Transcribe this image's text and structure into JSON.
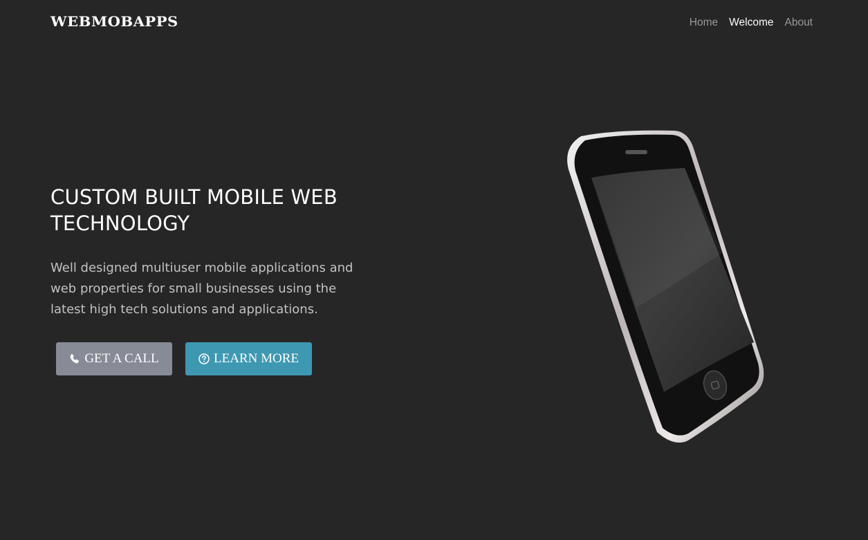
{
  "brand": {
    "name": "WEBMOBAPPS"
  },
  "nav": {
    "items": [
      {
        "label": "Home",
        "active": false
      },
      {
        "label": "Welcome",
        "active": true
      },
      {
        "label": "About",
        "active": false
      }
    ]
  },
  "hero": {
    "title": "CUSTOM BUILT MOBILE WEB TECHNOLOGY",
    "text": "Well designed multiuser mobile applications and web properties for small businesses using the latest high tech solutions and applications.",
    "call_button": {
      "label": "GET A CALL",
      "icon": "phone-icon",
      "color": "#878b96"
    },
    "more_button": {
      "label": "LEARN MORE",
      "icon": "question-circle-icon",
      "color": "#3e98b2"
    },
    "image": {
      "icon": "smartphone-illustration"
    }
  },
  "colors": {
    "background": "#262626",
    "text": "#ffffff",
    "muted": "#9a9a9a"
  }
}
